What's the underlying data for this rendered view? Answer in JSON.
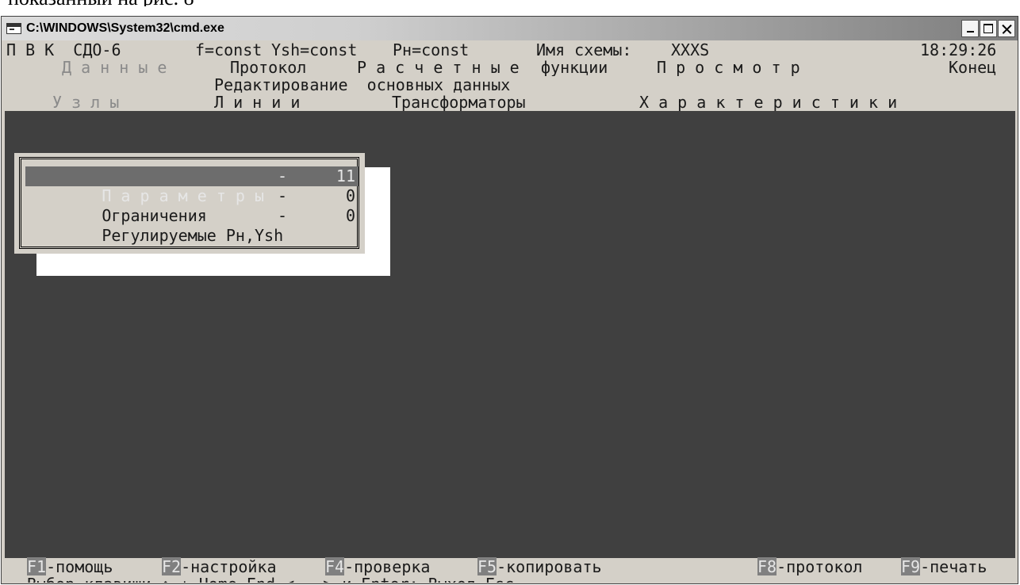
{
  "caption_fragment": "показанный на рис. 8",
  "window": {
    "title": "C:\\WINDOWS\\System32\\cmd.exe",
    "icon": "console-icon",
    "buttons": [
      "minimize-icon",
      "maximize-icon",
      "close-icon"
    ]
  },
  "status_line": {
    "app": "П В К  СДО-6",
    "f": "f=const",
    "ysh": "Ysh=const",
    "ph": "Pн=const",
    "scheme_label": "Имя схемы:",
    "scheme_name": "XXXS",
    "time": "18:29:26"
  },
  "main_menu": [
    {
      "label": "Д а н н ы е",
      "state": "selected"
    },
    {
      "label": "Протокол",
      "state": "normal"
    },
    {
      "label": "Р а с ч е т н ы е",
      "state": "normal"
    },
    {
      "label": "функции",
      "state": "normal"
    },
    {
      "label": "П р о с м о т р",
      "state": "normal"
    },
    {
      "label": "Конец",
      "state": "normal"
    }
  ],
  "section_title": "Редактирование  основных данных",
  "sub_menu": [
    {
      "label": "У з л ы",
      "state": "selected"
    },
    {
      "label": "Л и н и и",
      "state": "normal"
    },
    {
      "label": "Трансформаторы",
      "state": "normal"
    },
    {
      "label": "Х а р а к т е р и с т и к и",
      "state": "normal"
    }
  ],
  "panel_items": [
    {
      "label": "П а р а м е т р ы",
      "dash": "-",
      "value": "11",
      "active": true
    },
    {
      "label": "Ограничения",
      "dash": "-",
      "value": "0",
      "active": false
    },
    {
      "label": "Регулируемые Pн,Ysh",
      "dash": "-",
      "value": "0",
      "active": false
    }
  ],
  "function_keys": [
    {
      "key": "F1",
      "label": "-помощь"
    },
    {
      "key": "F2",
      "label": "-настройка"
    },
    {
      "key": "F4",
      "label": "-проверка"
    },
    {
      "key": "F5",
      "label": "-копировать"
    },
    {
      "key": "F8",
      "label": "-протокол"
    },
    {
      "key": "F9",
      "label": "-печать"
    }
  ],
  "hint": "Выбор-клавиши ↑,↓,Home,End,<-,-> и Enter; Выход-Esc",
  "colors": {
    "console_bg": "#404040",
    "light_bg": "#d4d0c8",
    "highlight": "#6d6d6d",
    "dim_text": "#8a8a8a"
  }
}
